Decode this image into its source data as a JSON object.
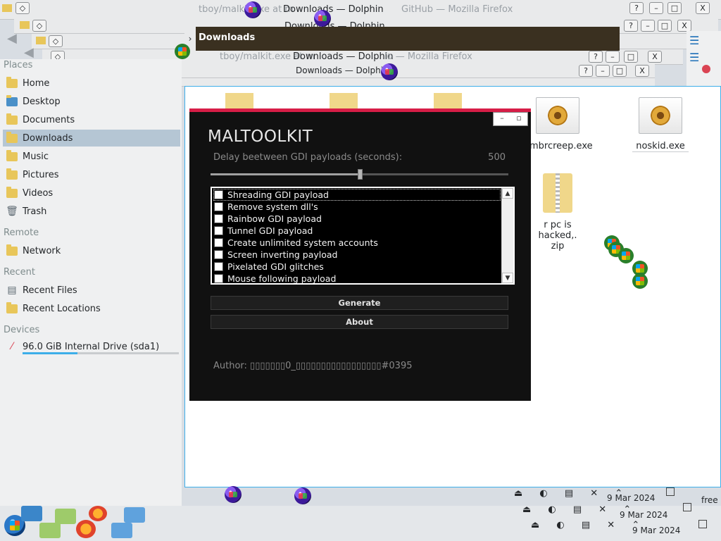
{
  "window": {
    "title": "Downloads — Dolphin",
    "ghost_title_1": "Downloads — Dolphin",
    "ghost_title_2": "Downloads — Dolphin",
    "ghost_title_3": "Downloads — Dolphin",
    "faded_left": "tboy/malkit.exe at m",
    "faded_right": "GitHub — Mozilla Firefox",
    "faded_right_2": "lo — Mozilla Firefox",
    "faded_left_2": "tboy/malkit.exe at m",
    "btn_help": "?",
    "btn_min": "–",
    "btn_max": "□",
    "btn_close": "X"
  },
  "header": {
    "title": "Downloads",
    "arrow": "›"
  },
  "sidebar": {
    "places_label": "Places",
    "places": [
      {
        "label": "Home"
      },
      {
        "label": "Desktop"
      },
      {
        "label": "Documents"
      },
      {
        "label": "Downloads"
      },
      {
        "label": "Music"
      },
      {
        "label": "Pictures"
      },
      {
        "label": "Videos"
      },
      {
        "label": "Trash"
      }
    ],
    "remote_label": "Remote",
    "remote": [
      {
        "label": "Network"
      }
    ],
    "recent_label": "Recent",
    "recent": [
      {
        "label": "Recent Files"
      },
      {
        "label": "Recent Locations"
      }
    ],
    "devices_label": "Devices",
    "devices": [
      {
        "label": "96.0 GiB Internal Drive (sda1)"
      }
    ]
  },
  "files": {
    "exe1": "mbrcreep.exe",
    "exe2": "noskid.exe",
    "zip_line1": "r pc is hacked,.",
    "zip_line2": "zip"
  },
  "app": {
    "title": "MALTOOLKIT",
    "delay_label": "Delay beetween GDI payloads (seconds):",
    "delay_value": "500",
    "delay_fraction": 0.5,
    "ctrl_min": "–",
    "ctrl_max": "▫",
    "payloads": [
      {
        "label": "Shreading GDI payload"
      },
      {
        "label": "Remove system dll's"
      },
      {
        "label": "Rainbow GDI payload"
      },
      {
        "label": "Tunnel GDI payload"
      },
      {
        "label": "Create unlimited system accounts"
      },
      {
        "label": "Screen inverting payload"
      },
      {
        "label": "Pixelated GDI glitches"
      },
      {
        "label": "Mouse following payload"
      }
    ],
    "generate_label": "Generate",
    "about_label": "About",
    "author": "Author: ▯▯▯▯▯▯▯0_▯▯▯▯▯▯▯▯▯▯▯▯▯▯▯▯▯#0395"
  },
  "tray": {
    "date1": "9 Mar 2024",
    "date2": "9 Mar 2024",
    "date3": "9 Mar 2024",
    "free": "free"
  }
}
